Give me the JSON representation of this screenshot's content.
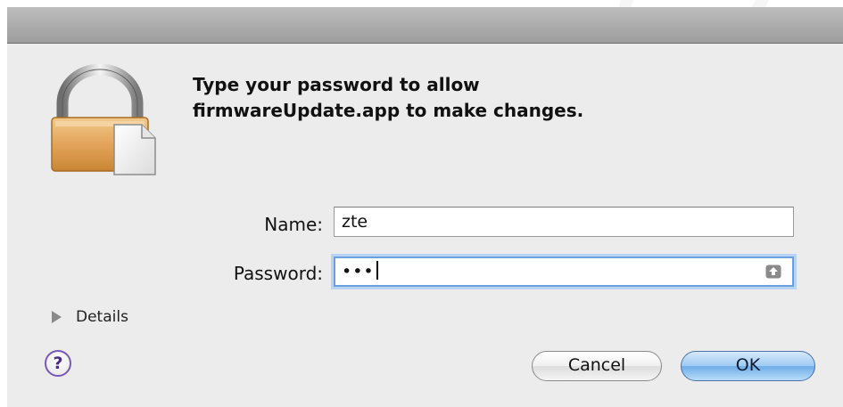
{
  "dialog": {
    "message_line1": "Type your password to allow",
    "message_line2": "firmwareUpdate.app to make changes."
  },
  "form": {
    "name_label": "Name:",
    "name_value": "zte",
    "password_label": "Password:",
    "password_masked": "•••"
  },
  "details": {
    "label": "Details",
    "icon": "disclosure-triangle-right"
  },
  "help": {
    "label": "?"
  },
  "buttons": {
    "cancel_label": "Cancel",
    "ok_label": "OK"
  },
  "icons": {
    "lock": "lock-icon",
    "capslock": "capslock-icon"
  },
  "colors": {
    "dialog_bg": "#ececec",
    "focus_ring": "#6a9fe0",
    "ok_button": "#8cc0ef",
    "lock_body": "#e2a758",
    "help_ring": "#7a58b5"
  }
}
